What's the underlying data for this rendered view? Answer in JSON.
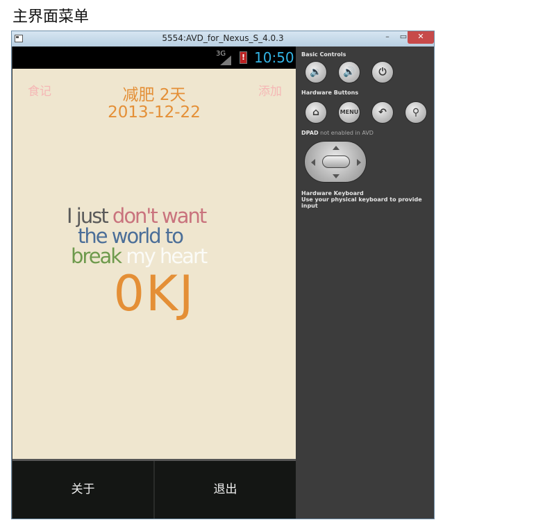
{
  "document": {
    "heading": "主界面菜单"
  },
  "window": {
    "title": "5554:AVD_for_Nexus_S_4.0.3",
    "minimize_label": "–",
    "maximize_label": "▭",
    "close_label": "✕"
  },
  "statusbar": {
    "network": "3G",
    "battery_alert": "!",
    "time": "10:50"
  },
  "app": {
    "left_action": "食记",
    "right_action": "添加",
    "title": "减肥 2天",
    "date": "2013-12-22",
    "quote": {
      "line1_a": "I just ",
      "line1_b": "don't want",
      "line2": "the world to",
      "line3_a": "break ",
      "line3_b": "my heart"
    },
    "energy": "0KJ",
    "bottom": {
      "about": "关于",
      "exit": "退出"
    }
  },
  "emulator_controls": {
    "basic_controls_label": "Basic Controls",
    "hardware_buttons_label": "Hardware Buttons",
    "menu_button": "MENU",
    "dpad_label_a": "DPAD",
    "dpad_label_b": " not enabled in AVD",
    "keyboard_label": "Hardware Keyboard",
    "keyboard_hint": "Use your physical keyboard to provide input"
  },
  "colors": {
    "accent_orange": "#e48f36",
    "action_pink": "#f5b7b5",
    "clock_blue": "#33b5e5",
    "screen_bg": "#efe6cf",
    "panel_bg": "#3c3c3c"
  }
}
